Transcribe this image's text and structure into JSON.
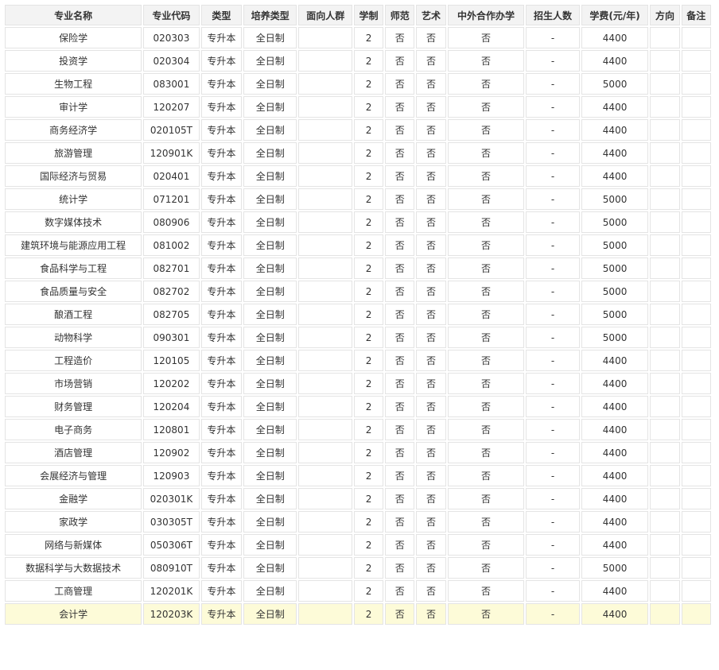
{
  "headers": [
    "专业名称",
    "专业代码",
    "类型",
    "培养类型",
    "面向人群",
    "学制",
    "师范",
    "艺术",
    "中外合作办学",
    "招生人数",
    "学费(元/年)",
    "方向",
    "备注"
  ],
  "rows": [
    [
      "保险学",
      "020303",
      "专升本",
      "全日制",
      "",
      "2",
      "否",
      "否",
      "否",
      "-",
      "4400",
      "",
      ""
    ],
    [
      "投资学",
      "020304",
      "专升本",
      "全日制",
      "",
      "2",
      "否",
      "否",
      "否",
      "-",
      "4400",
      "",
      ""
    ],
    [
      "生物工程",
      "083001",
      "专升本",
      "全日制",
      "",
      "2",
      "否",
      "否",
      "否",
      "-",
      "5000",
      "",
      ""
    ],
    [
      "审计学",
      "120207",
      "专升本",
      "全日制",
      "",
      "2",
      "否",
      "否",
      "否",
      "-",
      "4400",
      "",
      ""
    ],
    [
      "商务经济学",
      "020105T",
      "专升本",
      "全日制",
      "",
      "2",
      "否",
      "否",
      "否",
      "-",
      "4400",
      "",
      ""
    ],
    [
      "旅游管理",
      "120901K",
      "专升本",
      "全日制",
      "",
      "2",
      "否",
      "否",
      "否",
      "-",
      "4400",
      "",
      ""
    ],
    [
      "国际经济与贸易",
      "020401",
      "专升本",
      "全日制",
      "",
      "2",
      "否",
      "否",
      "否",
      "-",
      "4400",
      "",
      ""
    ],
    [
      "统计学",
      "071201",
      "专升本",
      "全日制",
      "",
      "2",
      "否",
      "否",
      "否",
      "-",
      "5000",
      "",
      ""
    ],
    [
      "数字媒体技术",
      "080906",
      "专升本",
      "全日制",
      "",
      "2",
      "否",
      "否",
      "否",
      "-",
      "5000",
      "",
      ""
    ],
    [
      "建筑环境与能源应用工程",
      "081002",
      "专升本",
      "全日制",
      "",
      "2",
      "否",
      "否",
      "否",
      "-",
      "5000",
      "",
      ""
    ],
    [
      "食品科学与工程",
      "082701",
      "专升本",
      "全日制",
      "",
      "2",
      "否",
      "否",
      "否",
      "-",
      "5000",
      "",
      ""
    ],
    [
      "食品质量与安全",
      "082702",
      "专升本",
      "全日制",
      "",
      "2",
      "否",
      "否",
      "否",
      "-",
      "5000",
      "",
      ""
    ],
    [
      "酿酒工程",
      "082705",
      "专升本",
      "全日制",
      "",
      "2",
      "否",
      "否",
      "否",
      "-",
      "5000",
      "",
      ""
    ],
    [
      "动物科学",
      "090301",
      "专升本",
      "全日制",
      "",
      "2",
      "否",
      "否",
      "否",
      "-",
      "5000",
      "",
      ""
    ],
    [
      "工程造价",
      "120105",
      "专升本",
      "全日制",
      "",
      "2",
      "否",
      "否",
      "否",
      "-",
      "4400",
      "",
      ""
    ],
    [
      "市场营销",
      "120202",
      "专升本",
      "全日制",
      "",
      "2",
      "否",
      "否",
      "否",
      "-",
      "4400",
      "",
      ""
    ],
    [
      "财务管理",
      "120204",
      "专升本",
      "全日制",
      "",
      "2",
      "否",
      "否",
      "否",
      "-",
      "4400",
      "",
      ""
    ],
    [
      "电子商务",
      "120801",
      "专升本",
      "全日制",
      "",
      "2",
      "否",
      "否",
      "否",
      "-",
      "4400",
      "",
      ""
    ],
    [
      "酒店管理",
      "120902",
      "专升本",
      "全日制",
      "",
      "2",
      "否",
      "否",
      "否",
      "-",
      "4400",
      "",
      ""
    ],
    [
      "会展经济与管理",
      "120903",
      "专升本",
      "全日制",
      "",
      "2",
      "否",
      "否",
      "否",
      "-",
      "4400",
      "",
      ""
    ],
    [
      "金融学",
      "020301K",
      "专升本",
      "全日制",
      "",
      "2",
      "否",
      "否",
      "否",
      "-",
      "4400",
      "",
      ""
    ],
    [
      "家政学",
      "030305T",
      "专升本",
      "全日制",
      "",
      "2",
      "否",
      "否",
      "否",
      "-",
      "4400",
      "",
      ""
    ],
    [
      "网络与新媒体",
      "050306T",
      "专升本",
      "全日制",
      "",
      "2",
      "否",
      "否",
      "否",
      "-",
      "4400",
      "",
      ""
    ],
    [
      "数据科学与大数据技术",
      "080910T",
      "专升本",
      "全日制",
      "",
      "2",
      "否",
      "否",
      "否",
      "-",
      "5000",
      "",
      ""
    ],
    [
      "工商管理",
      "120201K",
      "专升本",
      "全日制",
      "",
      "2",
      "否",
      "否",
      "否",
      "-",
      "4400",
      "",
      ""
    ],
    [
      "会计学",
      "120203K",
      "专升本",
      "全日制",
      "",
      "2",
      "否",
      "否",
      "否",
      "-",
      "4400",
      "",
      ""
    ]
  ],
  "highlight_row_color": "#fdfbd8"
}
